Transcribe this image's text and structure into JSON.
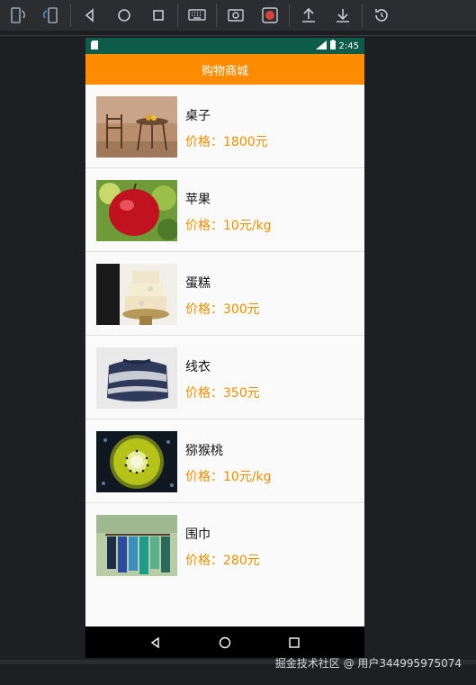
{
  "toolbar": {
    "icons": [
      "rotate-left-icon",
      "rotate-right-icon",
      "back-icon",
      "home-icon",
      "overview-icon",
      "keyboard-icon",
      "screenshot-icon",
      "record-icon",
      "upload-icon",
      "download-icon",
      "restore-icon"
    ]
  },
  "status_bar": {
    "time": "2:45",
    "network": "LTE"
  },
  "app_title": "购物商城",
  "products": [
    {
      "name": "桌子",
      "price": "价格：1800元",
      "image": "table-photo"
    },
    {
      "name": "苹果",
      "price": "价格：10元/kg",
      "image": "apple-photo"
    },
    {
      "name": "蛋糕",
      "price": "价格：300元",
      "image": "cake-photo"
    },
    {
      "name": "线衣",
      "price": "价格：350元",
      "image": "sweater-photo"
    },
    {
      "name": "猕猴桃",
      "price": "价格：10元/kg",
      "image": "kiwi-photo"
    },
    {
      "name": "围巾",
      "price": "价格：280元",
      "image": "scarf-photo"
    }
  ],
  "watermark": "掘金技术社区 @ 用户344995975074",
  "colors": {
    "accent": "#ff8c00",
    "price": "#ee8f00",
    "status_bar": "#0d5c4a"
  }
}
